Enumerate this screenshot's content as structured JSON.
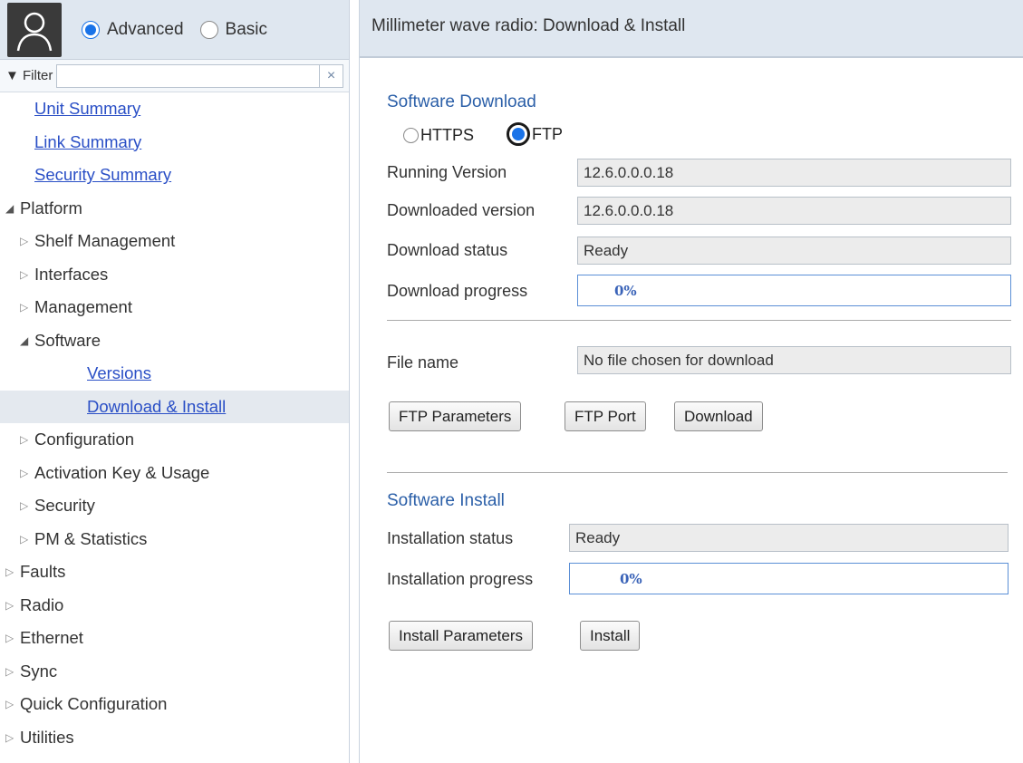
{
  "sidebar": {
    "mode_options": [
      {
        "label": "Advanced",
        "selected": true
      },
      {
        "label": "Basic",
        "selected": false
      }
    ],
    "filter": {
      "label": "▼ Filter",
      "value": "",
      "clear": "×"
    },
    "tree": [
      {
        "label": "Unit Summary",
        "type": "link"
      },
      {
        "label": "Link Summary",
        "type": "link"
      },
      {
        "label": "Security Summary",
        "type": "link"
      },
      {
        "label": "Platform",
        "state": "expanded"
      },
      {
        "label": "Shelf Management",
        "state": "collapsed"
      },
      {
        "label": "Interfaces",
        "state": "collapsed"
      },
      {
        "label": "Management",
        "state": "collapsed"
      },
      {
        "label": "Software",
        "state": "expanded"
      },
      {
        "label": "Versions",
        "type": "link"
      },
      {
        "label": "Download & Install",
        "type": "link",
        "selected": true
      },
      {
        "label": "Configuration",
        "state": "collapsed"
      },
      {
        "label": "Activation Key & Usage",
        "state": "collapsed"
      },
      {
        "label": "Security",
        "state": "collapsed"
      },
      {
        "label": "PM & Statistics",
        "state": "collapsed"
      },
      {
        "label": "Faults",
        "state": "collapsed"
      },
      {
        "label": "Radio",
        "state": "collapsed"
      },
      {
        "label": "Ethernet",
        "state": "collapsed"
      },
      {
        "label": "Sync",
        "state": "collapsed"
      },
      {
        "label": "Quick Configuration",
        "state": "collapsed"
      },
      {
        "label": "Utilities",
        "state": "collapsed"
      }
    ]
  },
  "main": {
    "title": "Millimeter wave radio: Download & Install",
    "download": {
      "section_title": "Software Download",
      "protocols": [
        {
          "label": "HTTPS",
          "selected": false
        },
        {
          "label": "FTP",
          "selected": true
        }
      ],
      "fields": [
        {
          "label": "Running Version",
          "value": "12.6.0.0.0.18"
        },
        {
          "label": "Downloaded version",
          "value": "12.6.0.0.0.18"
        },
        {
          "label": "Download status",
          "value": "Ready"
        }
      ],
      "progress_label": "Download progress",
      "progress_text": "0%",
      "progress_fraction": 0,
      "file_name_label": "File name",
      "file_name_value": "No file chosen for download",
      "buttons": [
        "FTP Parameters",
        "FTP Port",
        "Download"
      ]
    },
    "install": {
      "section_title": "Software Install",
      "status_label": "Installation status",
      "status_value": "Ready",
      "progress_label": "Installation progress",
      "progress_text": "0%",
      "progress_fraction": 0,
      "buttons": [
        "Install Parameters",
        "Install"
      ]
    }
  }
}
